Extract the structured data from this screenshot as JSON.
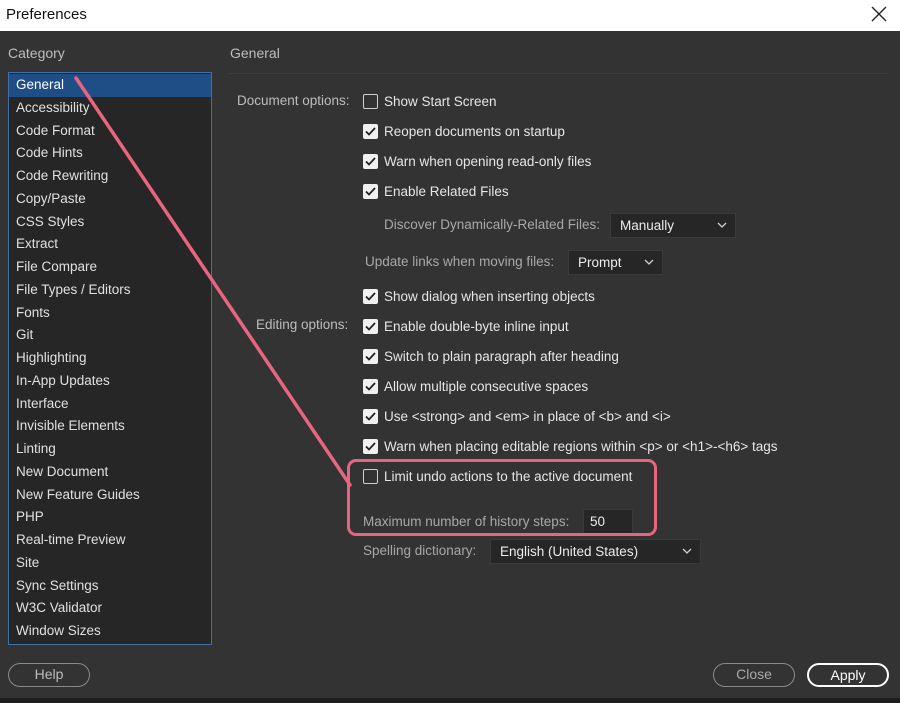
{
  "window": {
    "title": "Preferences"
  },
  "category": {
    "heading": "Category",
    "items": [
      "General",
      "Accessibility",
      "Code Format",
      "Code Hints",
      "Code Rewriting",
      "Copy/Paste",
      "CSS Styles",
      "Extract",
      "File Compare",
      "File Types / Editors",
      "Fonts",
      "Git",
      "Highlighting",
      "In-App Updates",
      "Interface",
      "Invisible Elements",
      "Linting",
      "New Document",
      "New Feature Guides",
      "PHP",
      "Real-time Preview",
      "Site",
      "Sync Settings",
      "W3C Validator",
      "Window Sizes"
    ],
    "selected": "General"
  },
  "section": {
    "heading": "General",
    "document_options_label": "Document options:",
    "editing_options_label": "Editing options:",
    "show_start_screen": {
      "label": "Show Start Screen",
      "checked": false
    },
    "reopen_documents": {
      "label": "Reopen documents on startup",
      "checked": true
    },
    "warn_read_only": {
      "label": "Warn when opening read-only files",
      "checked": true
    },
    "enable_related_files": {
      "label": "Enable Related Files",
      "checked": true
    },
    "discover_label": "Discover Dynamically-Related Files:",
    "discover_value": "Manually",
    "update_links_label": "Update links when moving files:",
    "update_links_value": "Prompt",
    "show_dialog_inserting": {
      "label": "Show dialog when inserting objects",
      "checked": true
    },
    "double_byte": {
      "label": "Enable double-byte inline input",
      "checked": true
    },
    "plain_paragraph": {
      "label": "Switch to plain paragraph after heading",
      "checked": true
    },
    "multiple_spaces": {
      "label": "Allow multiple consecutive spaces",
      "checked": true
    },
    "strong_em": {
      "label": "Use <strong> and <em> in place of <b> and <i>",
      "checked": true
    },
    "warn_editable_regions": {
      "label": "Warn when placing editable regions within <p> or <h1>-<h6> tags",
      "checked": true
    },
    "limit_undo": {
      "label": "Limit undo actions to the active document",
      "checked": false
    },
    "history_steps_label": "Maximum number of history steps:",
    "history_steps_value": "50",
    "spelling_label": "Spelling dictionary:",
    "spelling_value": "English (United States)"
  },
  "buttons": {
    "help": "Help",
    "close": "Close",
    "apply": "Apply"
  },
  "colors": {
    "accent": "#1f4e86",
    "highlight": "#e8657f",
    "background": "#333333"
  }
}
